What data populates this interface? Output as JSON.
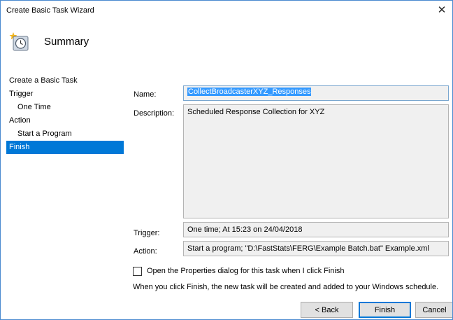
{
  "window": {
    "title": "Create Basic Task Wizard",
    "close_glyph": "✕"
  },
  "header": {
    "title": "Summary",
    "icon": "task-clock-icon"
  },
  "sidebar": {
    "items": [
      {
        "label": "Create a Basic Task"
      },
      {
        "label": "Trigger"
      },
      {
        "label": "One Time"
      },
      {
        "label": "Action"
      },
      {
        "label": "Start a Program"
      },
      {
        "label": "Finish"
      }
    ],
    "active_index": 5
  },
  "summary": {
    "name_label": "Name:",
    "name_value": "CollectBroadcasterXYZ_Responses",
    "description_label": "Description:",
    "description_value": "Scheduled Response Collection for XYZ",
    "trigger_label": "Trigger:",
    "trigger_value": "One time; At 15:23 on 24/04/2018",
    "action_label": "Action:",
    "action_value": "Start a program; \"D:\\FastStats\\FERG\\Example Batch.bat\" Example.xml"
  },
  "options": {
    "open_properties_label": "Open the Properties dialog for this task when I click Finish",
    "open_properties_checked": false,
    "info": "When you click Finish, the new task will be created and added to your Windows schedule."
  },
  "buttons": {
    "back": "< Back",
    "finish": "Finish",
    "cancel": "Cancel"
  },
  "colors": {
    "accent": "#0078d7",
    "selection": "#3399ff",
    "field_bg": "#f0f0f0"
  }
}
